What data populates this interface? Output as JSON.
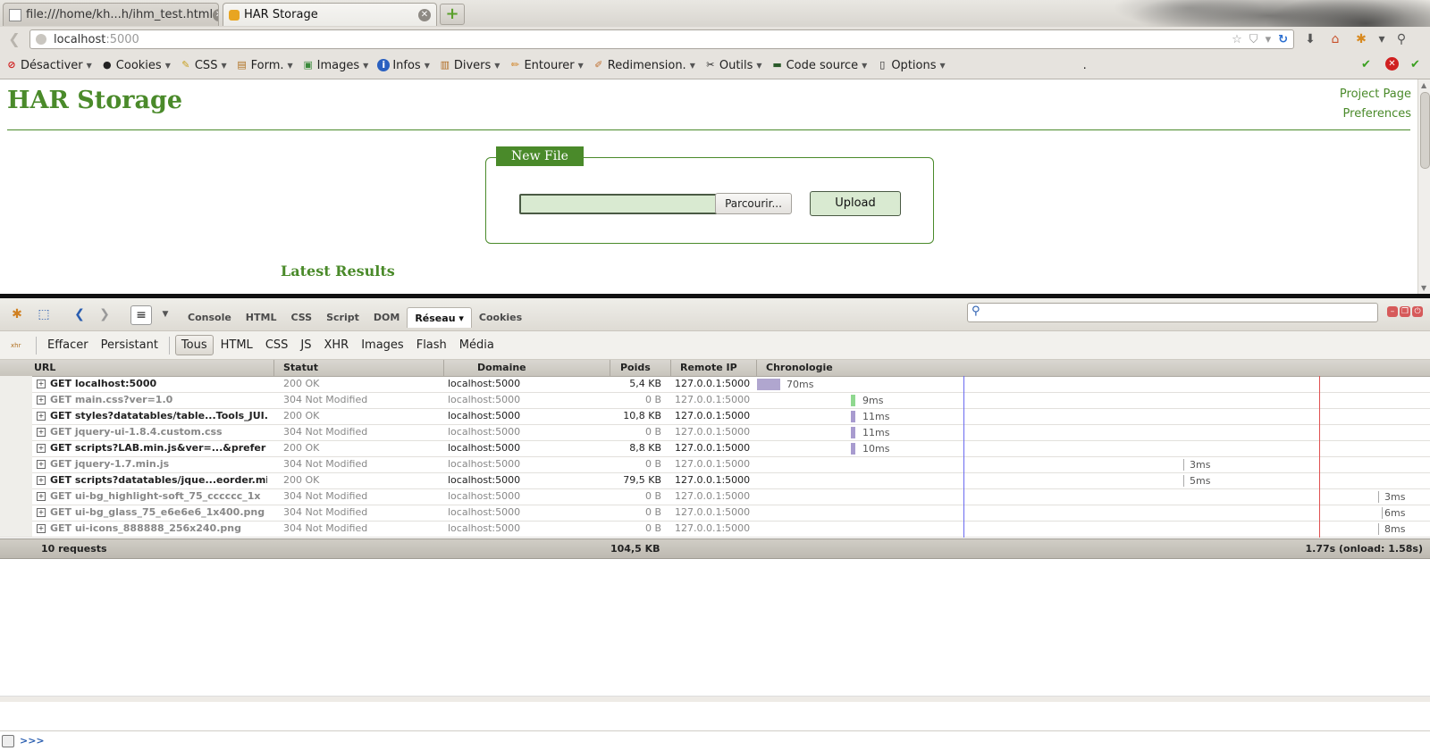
{
  "browser": {
    "tabs": [
      {
        "title": "file:///home/kh...h/ihm_test.html",
        "active": false
      },
      {
        "title": "HAR Storage",
        "active": true
      }
    ],
    "url_host": "localhost",
    "url_port": ":5000"
  },
  "webdev_toolbar": {
    "items": [
      "Désactiver",
      "Cookies",
      "CSS",
      "Form.",
      "Images",
      "Infos",
      "Divers",
      "Entourer",
      "Redimension.",
      "Outils",
      "Code source",
      "Options"
    ],
    "dot": "."
  },
  "page": {
    "title": "HAR Storage",
    "links": [
      "Project Page",
      "Preferences"
    ],
    "new_file_legend": "New File",
    "browse_label": "Parcourir...",
    "upload_label": "Upload",
    "latest_results": "Latest Results"
  },
  "firebug": {
    "panels": [
      "Console",
      "HTML",
      "CSS",
      "Script",
      "DOM",
      "Réseau",
      "Cookies"
    ],
    "selected_panel": "Réseau",
    "filters": [
      "Effacer",
      "Persistant",
      "Tous",
      "HTML",
      "CSS",
      "JS",
      "XHR",
      "Images",
      "Flash",
      "Média"
    ],
    "selected_filter": "Tous",
    "xhr_icon_text": "xhr",
    "columns": {
      "url": "URL",
      "status": "Statut",
      "domain": "Domaine",
      "size": "Poids",
      "remote_ip": "Remote IP",
      "timeline": "Chronologie"
    },
    "requests": [
      {
        "url": "GET localhost:5000",
        "status": "200 OK",
        "domain": "localhost:5000",
        "size": "5,4 KB",
        "ip": "127.0.0.1:5000",
        "time": "70ms",
        "kind": "ok"
      },
      {
        "url": "GET main.css?ver=1.0",
        "status": "304 Not Modified",
        "domain": "localhost:5000",
        "size": "0 B",
        "ip": "127.0.0.1:5000",
        "time": "9ms",
        "kind": "mod"
      },
      {
        "url": "GET styles?datatables/table...Tools_JUI.",
        "status": "200 OK",
        "domain": "localhost:5000",
        "size": "10,8 KB",
        "ip": "127.0.0.1:5000",
        "time": "11ms",
        "kind": "ok"
      },
      {
        "url": "GET jquery-ui-1.8.4.custom.css",
        "status": "304 Not Modified",
        "domain": "localhost:5000",
        "size": "0 B",
        "ip": "127.0.0.1:5000",
        "time": "11ms",
        "kind": "mod"
      },
      {
        "url": "GET scripts?LAB.min.js&ver=...&prefer",
        "status": "200 OK",
        "domain": "localhost:5000",
        "size": "8,8 KB",
        "ip": "127.0.0.1:5000",
        "time": "10ms",
        "kind": "ok"
      },
      {
        "url": "GET jquery-1.7.min.js",
        "status": "304 Not Modified",
        "domain": "localhost:5000",
        "size": "0 B",
        "ip": "127.0.0.1:5000",
        "time": "3ms",
        "kind": "mod"
      },
      {
        "url": "GET scripts?datatables/jque...eorder.mi",
        "status": "200 OK",
        "domain": "localhost:5000",
        "size": "79,5 KB",
        "ip": "127.0.0.1:5000",
        "time": "5ms",
        "kind": "ok"
      },
      {
        "url": "GET ui-bg_highlight-soft_75_cccccc_1x",
        "status": "304 Not Modified",
        "domain": "localhost:5000",
        "size": "0 B",
        "ip": "127.0.0.1:5000",
        "time": "3ms",
        "kind": "mod"
      },
      {
        "url": "GET ui-bg_glass_75_e6e6e6_1x400.png",
        "status": "304 Not Modified",
        "domain": "localhost:5000",
        "size": "0 B",
        "ip": "127.0.0.1:5000",
        "time": "6ms",
        "kind": "mod"
      },
      {
        "url": "GET ui-icons_888888_256x240.png",
        "status": "304 Not Modified",
        "domain": "localhost:5000",
        "size": "0 B",
        "ip": "127.0.0.1:5000",
        "time": "8ms",
        "kind": "mod"
      }
    ],
    "summary": {
      "requests": "10 requests",
      "total_size": "104,5 KB",
      "timing": "1.77s (onload: 1.58s)"
    },
    "command_prompt": ">>>",
    "colors": {
      "bar_ok": "#b0a6cf",
      "bar_css": "#8fd88f",
      "bar_js": "#a89bcf",
      "onload_line": "#e05050",
      "domcontent_line": "#6a6af0"
    }
  }
}
